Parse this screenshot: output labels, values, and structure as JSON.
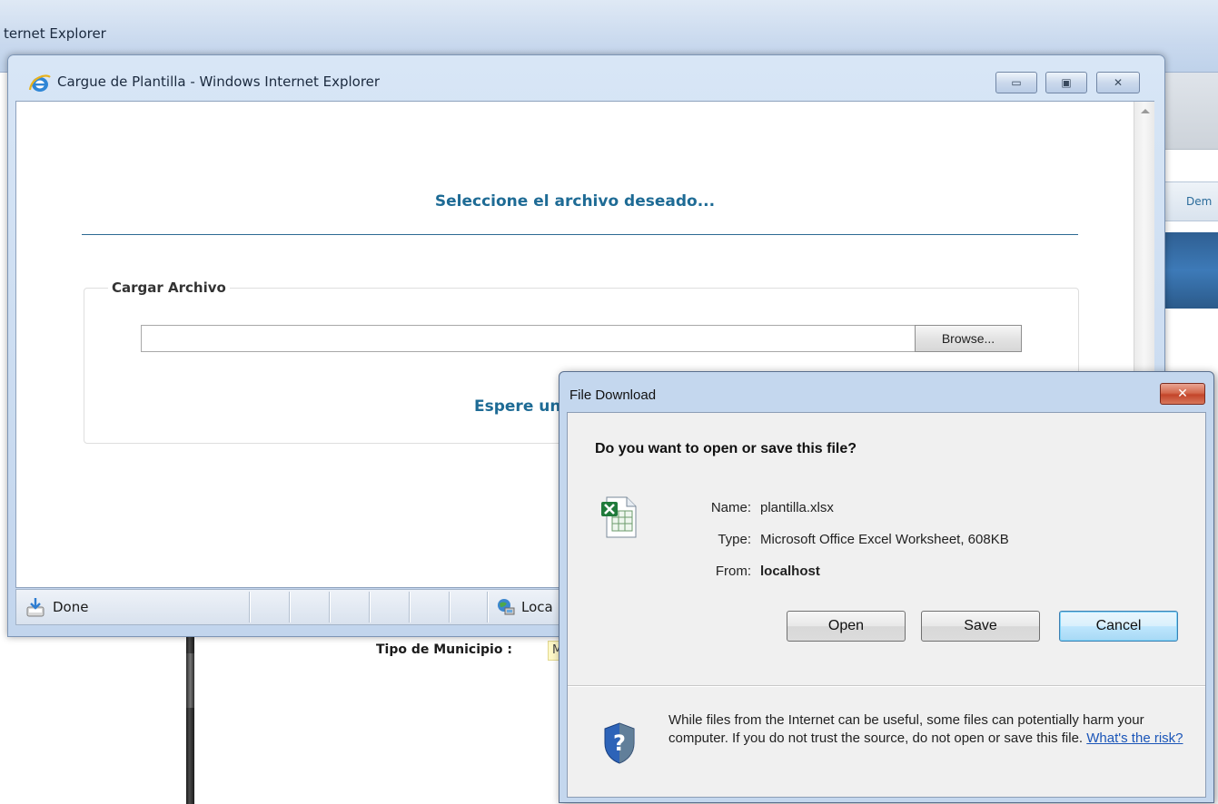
{
  "background": {
    "window_title": "ternet Explorer",
    "right_tab_label": "Dem",
    "field_label": "Tipo de Municipio :",
    "field_value": "M"
  },
  "ie_window": {
    "title": "Cargue de Plantilla - Windows Internet Explorer",
    "controls": {
      "minimize": "▭",
      "maximize": "▣",
      "close": "✕"
    },
    "heading": "Seleccione el archivo deseado...",
    "fieldset_legend": "Cargar Archivo",
    "file_input_value": "",
    "browse_label": "Browse...",
    "wait_message": "Espere unos instantes ...",
    "status": {
      "text": "Done",
      "zone": "Loca"
    }
  },
  "download_dialog": {
    "title": "File Download",
    "close_label": "✕",
    "question": "Do you want to open or save this file?",
    "file_info": {
      "name_label": "Name:",
      "name_value": "plantilla.xlsx",
      "type_label": "Type:",
      "type_value": "Microsoft Office Excel Worksheet, 608KB",
      "from_label": "From:",
      "from_value": "localhost"
    },
    "buttons": {
      "open": "Open",
      "save": "Save",
      "cancel": "Cancel"
    },
    "warning_text": "While files from the Internet can be useful, some files can potentially harm your computer. If you do not trust the source, do not open or save this file.",
    "risk_link": "What's the risk?"
  },
  "colors": {
    "accent_heading": "#1e6b95",
    "link": "#1a55b8",
    "close_red": "#c3452a"
  }
}
